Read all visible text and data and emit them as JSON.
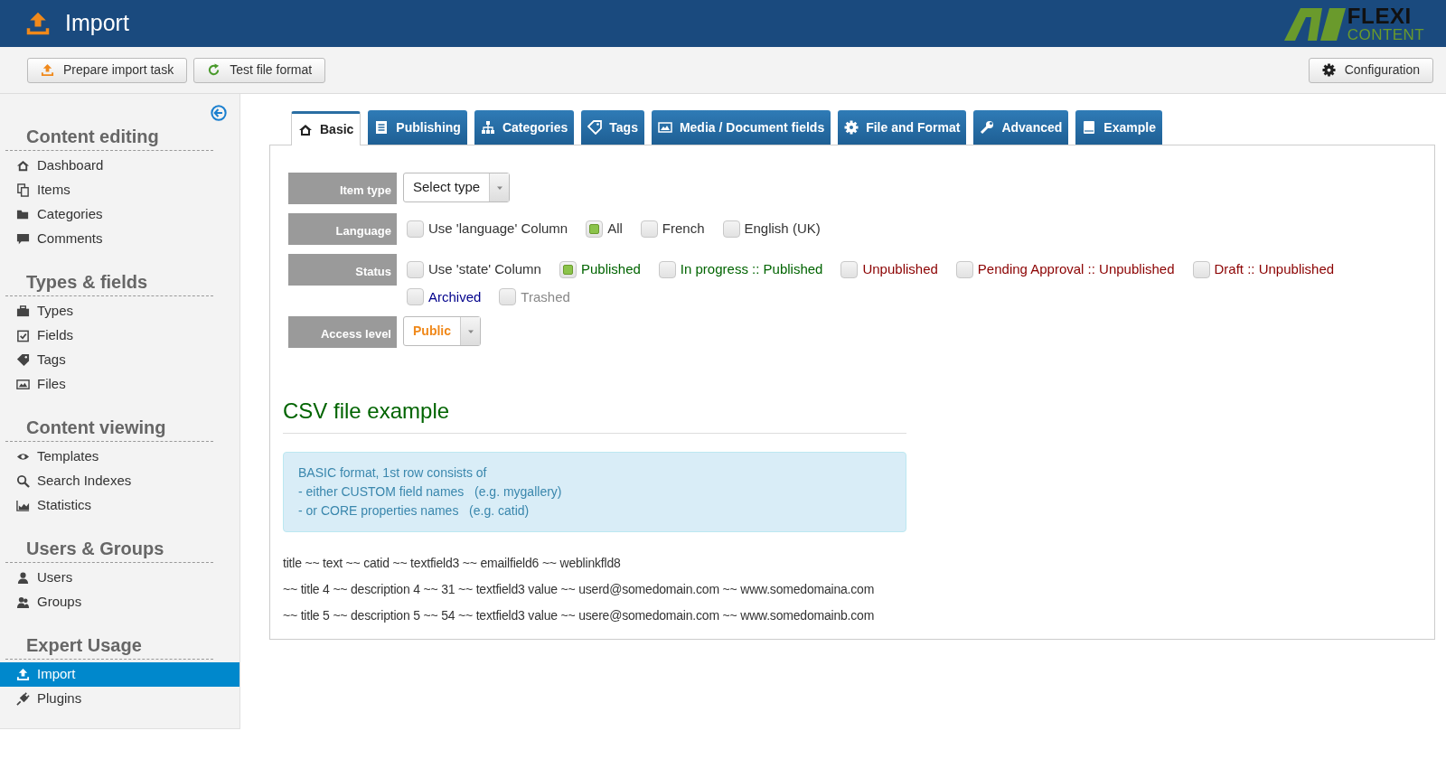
{
  "header": {
    "title": "Import",
    "logo": {
      "word_1": "FLEXI",
      "word_2": "CONTENT"
    }
  },
  "toolbar": {
    "buttons": [
      "Prepare import task",
      "Test file format"
    ],
    "right_button": "Configuration"
  },
  "sidebar": {
    "sections": [
      {
        "title": "Content editing",
        "items": [
          {
            "label": "Dashboard",
            "selected": false
          },
          {
            "label": "Items",
            "selected": false
          },
          {
            "label": "Categories",
            "selected": false
          },
          {
            "label": "Comments",
            "selected": false
          }
        ]
      },
      {
        "title": "Types & fields",
        "items": [
          {
            "label": "Types",
            "selected": false
          },
          {
            "label": "Fields",
            "selected": false
          },
          {
            "label": "Tags",
            "selected": false
          },
          {
            "label": "Files",
            "selected": false
          }
        ]
      },
      {
        "title": "Content viewing",
        "items": [
          {
            "label": "Templates",
            "selected": false
          },
          {
            "label": "Search Indexes",
            "selected": false
          },
          {
            "label": "Statistics",
            "selected": false
          }
        ]
      },
      {
        "title": "Users & Groups",
        "items": [
          {
            "label": "Users",
            "selected": false
          },
          {
            "label": "Groups",
            "selected": false
          }
        ]
      },
      {
        "title": "Expert Usage",
        "items": [
          {
            "label": "Import",
            "selected": true
          },
          {
            "label": "Plugins",
            "selected": false
          }
        ]
      }
    ]
  },
  "tabs": [
    {
      "label": "Basic",
      "selected": true
    },
    {
      "label": "Publishing",
      "selected": false
    },
    {
      "label": "Categories",
      "selected": false
    },
    {
      "label": "Tags",
      "selected": false
    },
    {
      "label": "Media / Document fields",
      "selected": false
    },
    {
      "label": "File and Format",
      "selected": false
    },
    {
      "label": "Advanced",
      "selected": false
    },
    {
      "label": "Example",
      "selected": false
    }
  ],
  "form": [
    {
      "kind": "select",
      "label": "Item type",
      "value": "Select type"
    },
    {
      "kind": "checks",
      "label": "Language",
      "options": [
        {
          "label": "Use 'language' Column",
          "checked": false,
          "color": "#333333"
        },
        {
          "label": "All",
          "checked": true,
          "color": "#333333"
        },
        {
          "label": "French",
          "checked": false,
          "color": "#333333"
        },
        {
          "label": "English (UK)",
          "checked": false,
          "color": "#333333"
        }
      ]
    },
    {
      "kind": "checks",
      "label": "Status",
      "options": [
        {
          "label": "Use 'state' Column",
          "checked": false,
          "color": "#333333"
        },
        {
          "label": "Published",
          "checked": true,
          "color": "#006400"
        },
        {
          "label": "In progress :: Published",
          "checked": false,
          "color": "#006400"
        },
        {
          "label": "Unpublished",
          "checked": false,
          "color": "#8b0000"
        },
        {
          "label": "Pending Approval :: Unpublished",
          "checked": false,
          "color": "#8b0000"
        },
        {
          "label": "Draft :: Unpublished",
          "checked": false,
          "color": "#8b0000"
        },
        {
          "label": "Archived",
          "checked": false,
          "color": "#00008b"
        },
        {
          "label": "Trashed",
          "checked": false,
          "color": "#888888"
        }
      ]
    },
    {
      "kind": "select",
      "label": "Access level",
      "value": "Public",
      "accent": true
    }
  ],
  "example": {
    "title": "CSV file example",
    "info": [
      "BASIC format, 1st row consists of",
      "- either CUSTOM field names   (e.g. mygallery)",
      "- or CORE properties names   (e.g. catid)"
    ],
    "lines": [
      "title ~~ text ~~ catid ~~ textfield3 ~~ emailfield6 ~~ weblinkfld8",
      "~~ title 4 ~~ description 4 ~~ 31 ~~ textfield3 value ~~ userd@somedomain.com ~~ www.somedomaina.com",
      "~~ title 5 ~~ description 5 ~~ 54 ~~ textfield3 value ~~ usere@somedomain.com ~~ www.somedomainb.com"
    ]
  }
}
